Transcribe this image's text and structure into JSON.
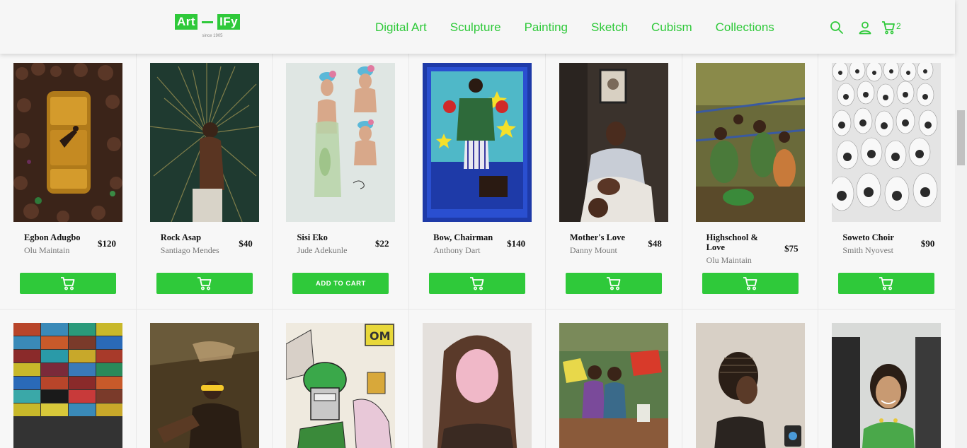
{
  "brand": {
    "part1": "Art",
    "part2": "IFy",
    "since": "since 1905"
  },
  "nav": [
    {
      "label": "Digital Art"
    },
    {
      "label": "Sculpture"
    },
    {
      "label": "Painting"
    },
    {
      "label": "Sketch"
    },
    {
      "label": "Cubism"
    },
    {
      "label": "Collections"
    }
  ],
  "header": {
    "cart_count": "2"
  },
  "colors": {
    "accent": "#2fc93a"
  },
  "add_to_cart_label": "ADD TO CART",
  "products": [
    {
      "title": "Egbon Adugbo",
      "artist": "Olu Maintain",
      "price": "$120"
    },
    {
      "title": "Rock Asap",
      "artist": "Santiago Mendes",
      "price": "$40"
    },
    {
      "title": "Sisi Eko",
      "artist": "Jude Adekunle",
      "price": "$22"
    },
    {
      "title": "Bow, Chairman",
      "artist": "Anthony Dart",
      "price": "$140"
    },
    {
      "title": "Mother's Love",
      "artist": "Danny Mount",
      "price": "$48"
    },
    {
      "title": "Highschool & Love",
      "artist": "Olu Maintain",
      "price": "$75"
    },
    {
      "title": "Soweto Choir",
      "artist": "Smith Nyovest",
      "price": "$90"
    }
  ]
}
